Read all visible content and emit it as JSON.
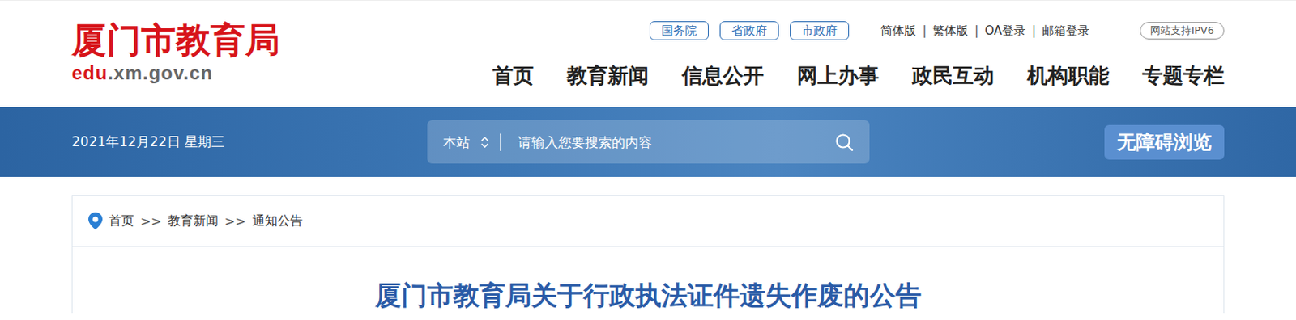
{
  "header": {
    "logo_title": "厦门市教育局",
    "domain_prefix": "edu",
    "domain_rest": ".xm.gov.cn"
  },
  "gov_links": [
    "国务院",
    "省政府",
    "市政府"
  ],
  "util_links": [
    "简体版",
    "繁体版",
    "OA登录",
    "邮箱登录"
  ],
  "util_separator": "|",
  "ipv6_badge": "网站支持IPV6",
  "nav": [
    {
      "label": "首页",
      "selected": false
    },
    {
      "label": "教育新闻",
      "selected": false
    },
    {
      "label": "信息公开",
      "selected": false
    },
    {
      "label": "网上办事",
      "selected": false
    },
    {
      "label": "政民互动",
      "selected": false
    },
    {
      "label": "机构职能",
      "selected": false
    },
    {
      "label": "专题专栏",
      "selected": false
    }
  ],
  "banner": {
    "date": "2021年12月22日 星期三",
    "search_scope": "本站",
    "search_placeholder": "请输入您要搜索的内容",
    "accessibility_button": "无障碍浏览"
  },
  "breadcrumb": {
    "items": [
      "首页",
      "教育新闻",
      "通知公告"
    ],
    "separator": ">>"
  },
  "article": {
    "title": "厦门市教育局关于行政执法证件遗失作废的公告"
  }
}
